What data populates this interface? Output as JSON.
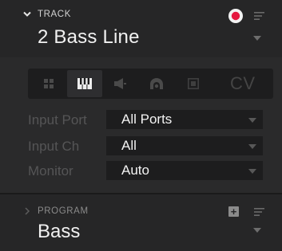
{
  "track": {
    "section_title": "TRACK",
    "name": "2 Bass Line"
  },
  "tabs": [
    {
      "id": "pads",
      "icon": "grid-icon"
    },
    {
      "id": "keys",
      "icon": "keyboard-icon",
      "active": true
    },
    {
      "id": "audio",
      "icon": "speaker-icon"
    },
    {
      "id": "plugin",
      "icon": "plugin-icon"
    },
    {
      "id": "sample",
      "icon": "sample-icon"
    },
    {
      "id": "cv",
      "label": "CV"
    }
  ],
  "params": {
    "input_port": {
      "label": "Input Port",
      "value": "All Ports"
    },
    "input_ch": {
      "label": "Input Ch",
      "value": "All"
    },
    "monitor": {
      "label": "Monitor",
      "value": "Auto"
    }
  },
  "program": {
    "section_title": "PROGRAM",
    "name": "Bass",
    "add_symbol": "+"
  },
  "colors": {
    "record": "#e5173f",
    "background": "#2a2a2b",
    "field": "#1d1d1e"
  }
}
